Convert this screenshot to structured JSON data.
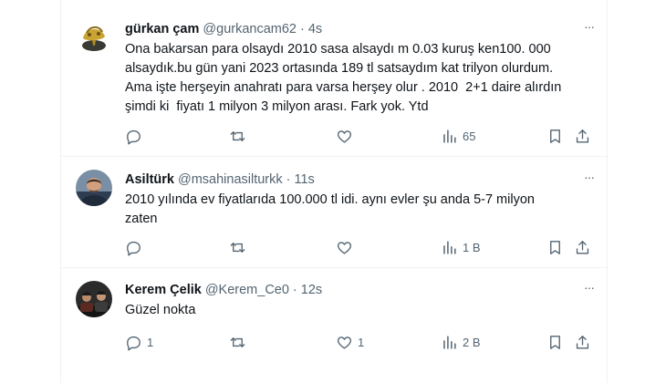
{
  "tweets": [
    {
      "name": "gürkan çam",
      "handle": "@gurkancam62",
      "separator": "·",
      "time": "4s",
      "text": "Ona bakarsan para olsaydı 2010 sasa alsaydı m 0.03 kuruş ken100. 000\nalsaydık.bu gün yani 2023 ortasında 189 tl satsaydım kat trilyon olurdum.\nAma işte herşeyin anahratı para varsa herşey olur . 2010  2+1 daire alırdın\nşimdi ki  fiyatı 1 milyon 3 milyon arası. Fark yok. Ytd",
      "replies": "",
      "retweets": "",
      "likes": "",
      "views": "65"
    },
    {
      "name": "Asiltürk",
      "handle": "@msahinasilturkk",
      "separator": "·",
      "time": "11s",
      "text": "2010 yılında ev fiyatlarıda 100.000 tl idi. aynı evler şu anda 5-7 milyon\nzaten",
      "replies": "",
      "retweets": "",
      "likes": "",
      "views": "1 B"
    },
    {
      "name": "Kerem Çelik",
      "handle": "@Kerem_Ce0",
      "separator": "·",
      "time": "12s",
      "text": "Güzel nokta",
      "replies": "1",
      "retweets": "",
      "likes": "1",
      "views": "2 B"
    }
  ],
  "more_glyph": "···",
  "colors": {
    "text": "#0f1419",
    "secondary": "#536471",
    "divider": "#eff3f4"
  },
  "icons": [
    "reply-icon",
    "retweet-icon",
    "like-icon",
    "views-icon",
    "bookmark-icon",
    "share-icon",
    "more-icon"
  ]
}
